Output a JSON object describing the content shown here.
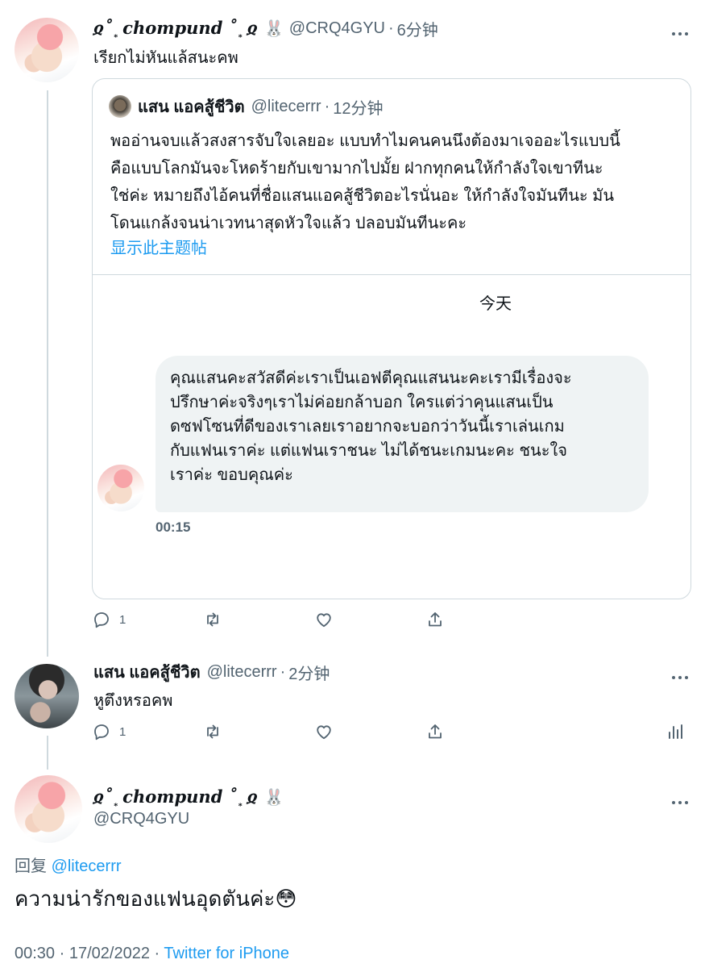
{
  "tweet1": {
    "display_name": "ჲ˚ ͙ chompund ˚ ͙ ჲ",
    "emoji": "🐰",
    "handle": "@CRQ4GYU",
    "sep": "·",
    "time": "6分钟",
    "text": "เรียกไม่หันแล้สนะคพ",
    "quote": {
      "name": "แสน แอคสู้ชีวิต",
      "handle": "@litecerrr",
      "sep": "·",
      "time": "12分钟",
      "lines": [
        "พออ่านจบแล้วสงสารจับใจเลยอะ แบบทำไมคนคนนึงต้องมาเจออะไรแบบนี้",
        "คือแบบโลกมันจะโหดร้ายกับเขามากไปมั้ย ฝากทุกคนให้กำลังใจเขาทีนะ",
        "ใช่ค่ะ หมายถึงไอ้คนที่ชื่อแสนแอคสู้ชีวิตอะไรนั่นอะ ให้กำลังใจมันทีนะ มัน",
        "โดนแกล้งจนน่าเวทนาสุดหัวใจแล้ว ปลอบมันทีนะคะ"
      ],
      "show_thread": "显示此主题帖",
      "dm": {
        "date_label": "今天",
        "lines": [
          "คุณแสนคะสวัสดีค่ะเราเป็นเอฟตีคุณแสนนะคะเรามีเรื่องจะ",
          "ปรึกษาค่ะจริงๆเราไม่ค่อยกล้าบอก ใครแต่ว่าคุนแสนเป็น",
          "ดซฟโซนที่ดีของเราเลยเราอยากจะบอกว่าวันนี้เราเล่นเกม",
          "กับแฟนเราค่ะ แต่แฟนเราชนะ ไม่ได้ชนะเกมนะคะ ชนะใจ",
          "เราค่ะ ขอบคุณค่ะ"
        ],
        "time": "00:15"
      }
    },
    "reply_count": "1"
  },
  "tweet2": {
    "name": "แสน แอคสู้ชีวิต",
    "handle": "@litecerrr",
    "sep": "·",
    "time": "2分钟",
    "text": "หูตึงหรอคพ",
    "reply_count": "1"
  },
  "main_tweet": {
    "display_name": "ჲ˚ ͙ chompund ˚ ͙ ჲ",
    "emoji": "🐰",
    "handle": "@CRQ4GYU",
    "reply_prefix": "回复",
    "reply_to": "@litecerrr",
    "text": "ความน่ารักของแฟนอุดตันค่ะ😳",
    "time": "00:30",
    "sep1": "·",
    "date": "17/02/2022",
    "sep2": "·",
    "source": "Twitter for iPhone"
  },
  "colors": {
    "text": "#0f1419",
    "secondary": "#536471",
    "accent": "#1d9bf0",
    "border": "#cfd9de",
    "bubble": "#eff3f4"
  }
}
